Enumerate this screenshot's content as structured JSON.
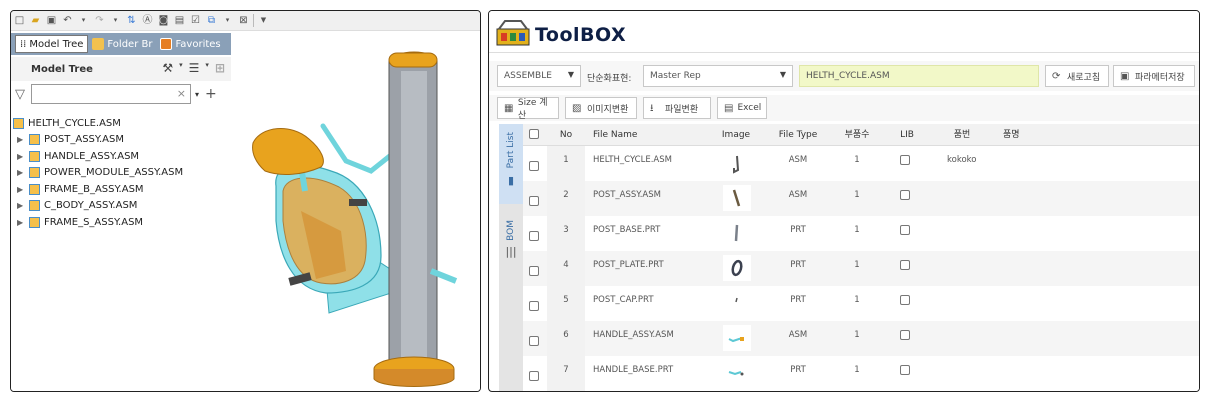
{
  "left": {
    "tabs": [
      {
        "label": "Model Tree"
      },
      {
        "label": "Folder Br"
      },
      {
        "label": "Favorites"
      }
    ],
    "model_tree_header": "Model Tree",
    "tree": [
      {
        "label": "HELTH_CYCLE.ASM",
        "expandable": false
      },
      {
        "label": "POST_ASSY.ASM",
        "expandable": true
      },
      {
        "label": "HANDLE_ASSY.ASM",
        "expandable": true
      },
      {
        "label": "POWER_MODULE_ASSY.ASM",
        "expandable": true
      },
      {
        "label": "FRAME_B_ASSY.ASM",
        "expandable": true
      },
      {
        "label": "C_BODY_ASSY.ASM",
        "expandable": true
      },
      {
        "label": "FRAME_S_ASSY.ASM",
        "expandable": true
      }
    ]
  },
  "right": {
    "title": "ToolBOX",
    "assemble_select": "ASSEMBLE",
    "simplified_rep_label": "단순화표현:",
    "rep_select": "Master Rep",
    "file_field": "HELTH_CYCLE.ASM",
    "refresh_label": "새로고침",
    "save_params_label": "파라메터저장",
    "tools": [
      {
        "label": "Size 계산"
      },
      {
        "label": "이미지변환"
      },
      {
        "label": "파일변환"
      },
      {
        "label": "Excel"
      }
    ],
    "side_tabs": [
      {
        "label": "Part List"
      },
      {
        "label": "BOM"
      }
    ],
    "columns": {
      "no": "No",
      "file_name": "File Name",
      "image": "Image",
      "file_type": "File Type",
      "count": "부품수",
      "lib": "LIB",
      "part_no": "품번",
      "part_name": "품명"
    },
    "rows": [
      {
        "no": "1",
        "file_name": "HELTH_CYCLE.ASM",
        "file_type": "ASM",
        "count": "1",
        "part_no": "kokoko",
        "part_name": ""
      },
      {
        "no": "2",
        "file_name": "POST_ASSY.ASM",
        "file_type": "ASM",
        "count": "1",
        "part_no": "",
        "part_name": ""
      },
      {
        "no": "3",
        "file_name": "POST_BASE.PRT",
        "file_type": "PRT",
        "count": "1",
        "part_no": "",
        "part_name": ""
      },
      {
        "no": "4",
        "file_name": "POST_PLATE.PRT",
        "file_type": "PRT",
        "count": "1",
        "part_no": "",
        "part_name": ""
      },
      {
        "no": "5",
        "file_name": "POST_CAP.PRT",
        "file_type": "PRT",
        "count": "1",
        "part_no": "",
        "part_name": ""
      },
      {
        "no": "6",
        "file_name": "HANDLE_ASSY.ASM",
        "file_type": "ASM",
        "count": "1",
        "part_no": "",
        "part_name": ""
      },
      {
        "no": "7",
        "file_name": "HANDLE_BASE.PRT",
        "file_type": "PRT",
        "count": "1",
        "part_no": "",
        "part_name": ""
      }
    ]
  }
}
